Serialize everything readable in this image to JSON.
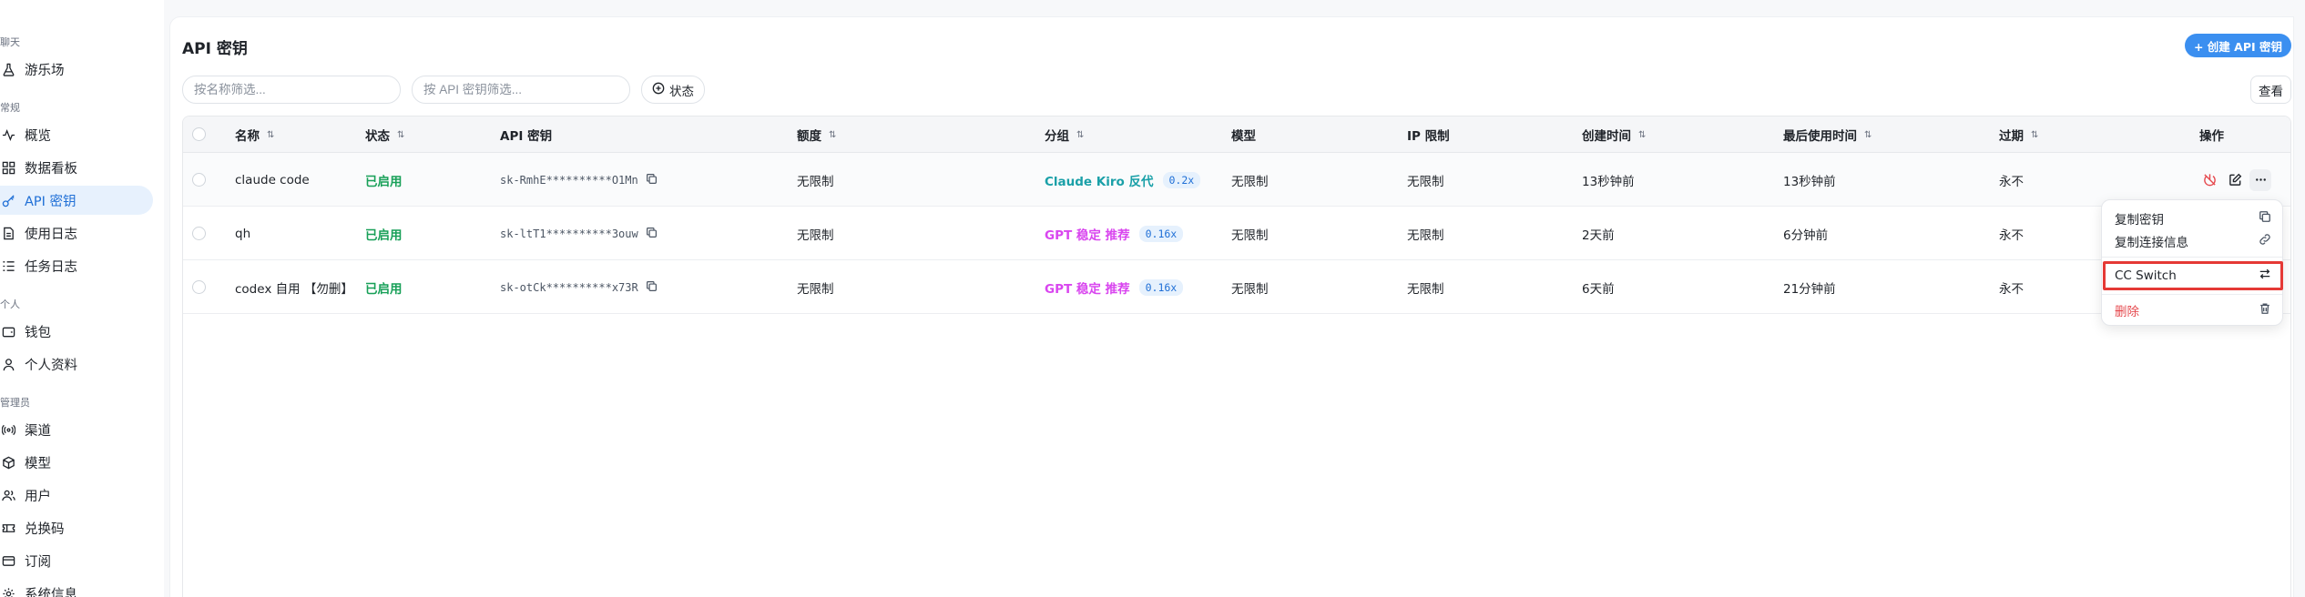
{
  "sidebar": {
    "sections": [
      {
        "title": "聊天",
        "items": [
          {
            "label": "游乐场",
            "icon": "flask-icon"
          }
        ]
      },
      {
        "title": "常规",
        "items": [
          {
            "label": "概览",
            "icon": "activity-icon"
          },
          {
            "label": "数据看板",
            "icon": "dashboard-icon"
          },
          {
            "label": "API 密钥",
            "icon": "key-icon",
            "active": true
          },
          {
            "label": "使用日志",
            "icon": "file-log-icon"
          },
          {
            "label": "任务日志",
            "icon": "task-list-icon"
          }
        ]
      },
      {
        "title": "个人",
        "items": [
          {
            "label": "钱包",
            "icon": "wallet-icon"
          },
          {
            "label": "个人资料",
            "icon": "user-icon"
          }
        ]
      },
      {
        "title": "管理员",
        "items": [
          {
            "label": "渠道",
            "icon": "radio-icon"
          },
          {
            "label": "模型",
            "icon": "box-icon"
          },
          {
            "label": "用户",
            "icon": "users-icon"
          },
          {
            "label": "兑换码",
            "icon": "ticket-icon"
          },
          {
            "label": "订阅",
            "icon": "card-icon"
          },
          {
            "label": "系统信息",
            "icon": "settings-icon"
          }
        ]
      }
    ]
  },
  "page": {
    "title": "API 密钥",
    "create_button": "+ 创建 API 密钥",
    "name_filter_placeholder": "按名称筛选...",
    "key_filter_placeholder": "按 API 密钥筛选...",
    "status_filter": "状态",
    "view_button": "查看"
  },
  "table": {
    "columns": [
      "名称",
      "状态",
      "API 密钥",
      "额度",
      "分组",
      "模型",
      "IP 限制",
      "创建时间",
      "最后使用时间",
      "过期",
      "操作"
    ],
    "rows": [
      {
        "name": "claude code",
        "status": "已启用",
        "key": "sk-RmhE**********O1Mn",
        "quota": "无限制",
        "group": "Claude Kiro 反代",
        "group_color": "#1aa0a8",
        "ratio": "0.2x",
        "models": "无限制",
        "ip_limit": "无限制",
        "created": "13秒钟前",
        "last_used": "13秒钟前",
        "expires": "永不"
      },
      {
        "name": "qh",
        "status": "已启用",
        "key": "sk-ltT1**********3ouw",
        "quota": "无限制",
        "group": "GPT 稳定 推荐",
        "group_color": "#d946ef",
        "ratio": "0.16x",
        "models": "无限制",
        "ip_limit": "无限制",
        "created": "2天前",
        "last_used": "6分钟前",
        "expires": "永不"
      },
      {
        "name": "codex 自用 【勿删】",
        "status": "已启用",
        "key": "sk-otCk**********x73R",
        "quota": "无限制",
        "group": "GPT 稳定 推荐",
        "group_color": "#d946ef",
        "ratio": "0.16x",
        "models": "无限制",
        "ip_limit": "无限制",
        "created": "6天前",
        "last_used": "21分钟前",
        "expires": "永不"
      }
    ]
  },
  "dropdown": {
    "copy_key": "复制密钥",
    "copy_connection": "复制连接信息",
    "cc_switch": "CC Switch",
    "delete": "删除"
  },
  "colors": {
    "accent": "#3b8ff0",
    "enabled": "#18a058",
    "danger": "#e5484d",
    "highlight_border": "#e53935"
  }
}
